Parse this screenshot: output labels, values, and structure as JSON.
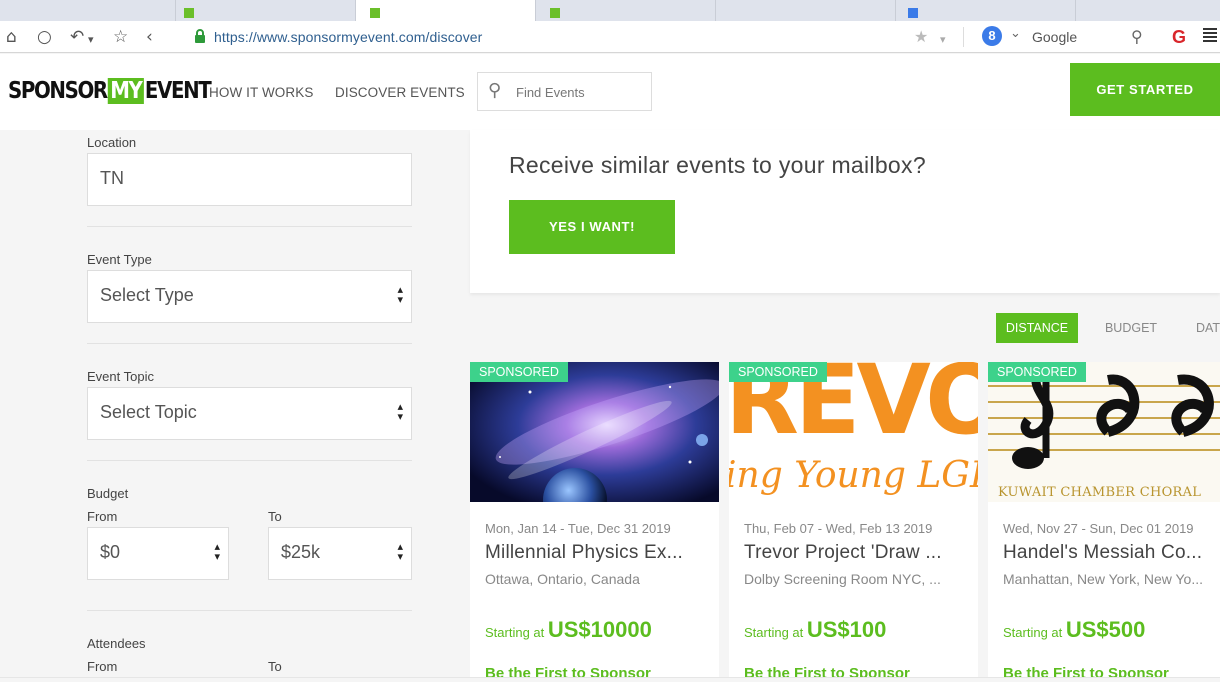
{
  "browser": {
    "url": "https://www.sponsormyevent.com/discover",
    "search_engine": "Google",
    "search_badge": "8"
  },
  "header": {
    "logo_pre": "SPONSOR",
    "logo_my": "MY",
    "logo_post": "EVENT",
    "nav": [
      "HOW IT WORKS",
      "DISCOVER EVENTS"
    ],
    "search_placeholder": "Find Events",
    "cta": "GET STARTED"
  },
  "filters": {
    "location_label": "Location",
    "location_value": "TN",
    "event_type_label": "Event Type",
    "event_type_value": "Select Type",
    "event_topic_label": "Event Topic",
    "event_topic_value": "Select Topic",
    "budget_label": "Budget",
    "budget_from_label": "From",
    "budget_to_label": "To",
    "budget_from": "$0",
    "budget_to": "$25k",
    "attendees_label": "Attendees",
    "attendees_from_label": "From",
    "attendees_to_label": "To"
  },
  "subscribe": {
    "heading": "Receive similar events to your mailbox?",
    "button": "YES I WANT!"
  },
  "sort": [
    "DISTANCE",
    "BUDGET",
    "DATE"
  ],
  "events": [
    {
      "badge": "SPONSORED",
      "date": "Mon, Jan 14 - Tue, Dec 31 2019",
      "title": "Millennial Physics Ex...",
      "location": "Ottawa, Ontario, Canada",
      "price_label": "Starting at ",
      "price": "US$10000",
      "cta": "Be the First to Sponsor"
    },
    {
      "badge": "SPONSORED",
      "image_text_top": "REVO",
      "image_text_bottom": "ing Young LGBTQ",
      "date": "Thu, Feb 07 - Wed, Feb 13 2019",
      "title": "Trevor Project 'Draw ...",
      "location": "Dolby Screening Room NYC, ...",
      "price_label": "Starting at ",
      "price": "US$100",
      "cta": "Be the First to Sponsor"
    },
    {
      "badge": "SPONSORED",
      "image_text": "KUWAIT CHAMBER CHORAL",
      "date": "Wed, Nov 27 - Sun, Dec 01 2019",
      "title": "Handel's Messiah Co...",
      "location": "Manhattan, New York, New Yo...",
      "price_label": "Starting at ",
      "price": "US$500",
      "cta": "Be the First to Sponsor"
    }
  ],
  "colors": {
    "brand_green": "#5cbd1f",
    "badge_green": "#3dd28b",
    "orange": "#f39121"
  }
}
